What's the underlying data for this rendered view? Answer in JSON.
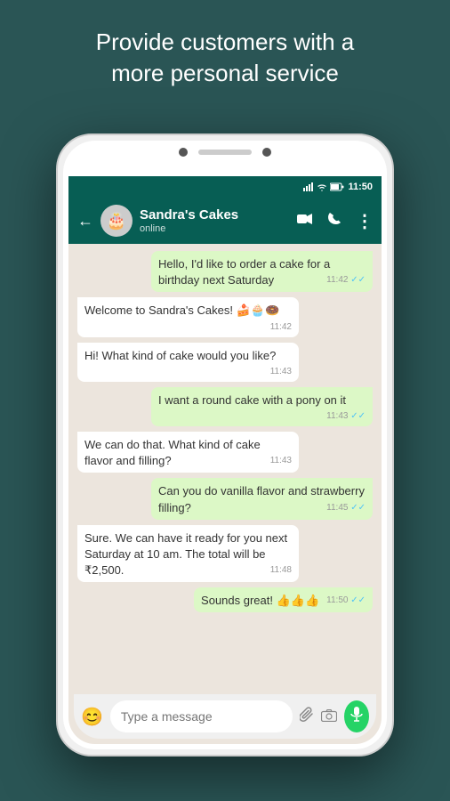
{
  "header": {
    "line1": "Provide customers with a",
    "line2": "more personal service"
  },
  "statusBar": {
    "time": "11:50",
    "icons": [
      "signal",
      "wifi",
      "battery"
    ]
  },
  "chatHeader": {
    "contactName": "Sandra's Cakes",
    "status": "online",
    "backLabel": "←",
    "avatarEmoji": "🎂",
    "actions": [
      "video",
      "phone",
      "more"
    ]
  },
  "messages": [
    {
      "id": 1,
      "type": "sent",
      "text": "Hello, I'd like to order a cake for a birthday next Saturday",
      "time": "11:42",
      "check": "double-blue"
    },
    {
      "id": 2,
      "type": "received",
      "text": "Welcome to Sandra's Cakes! 🍰🧁🍩",
      "time": "11:42"
    },
    {
      "id": 3,
      "type": "received",
      "text": "Hi! What kind of cake would you like?",
      "time": "11:43"
    },
    {
      "id": 4,
      "type": "sent",
      "text": "I want a round cake with a pony on it",
      "time": "11:43",
      "check": "double-blue"
    },
    {
      "id": 5,
      "type": "received",
      "text": "We can do that. What kind of cake flavor and filling?",
      "time": "11:43"
    },
    {
      "id": 6,
      "type": "sent",
      "text": "Can you do vanilla flavor and strawberry filling?",
      "time": "11:45",
      "check": "double-blue"
    },
    {
      "id": 7,
      "type": "received",
      "text": "Sure. We can have it ready for you next Saturday at 10 am. The total will be ₹2,500.",
      "time": "11:48"
    },
    {
      "id": 8,
      "type": "sent",
      "text": "Sounds great! 👍👍👍",
      "time": "11:50",
      "check": "double-blue"
    }
  ],
  "inputBar": {
    "placeholder": "Type a message",
    "emojiIcon": "😊",
    "micIcon": "🎤"
  }
}
